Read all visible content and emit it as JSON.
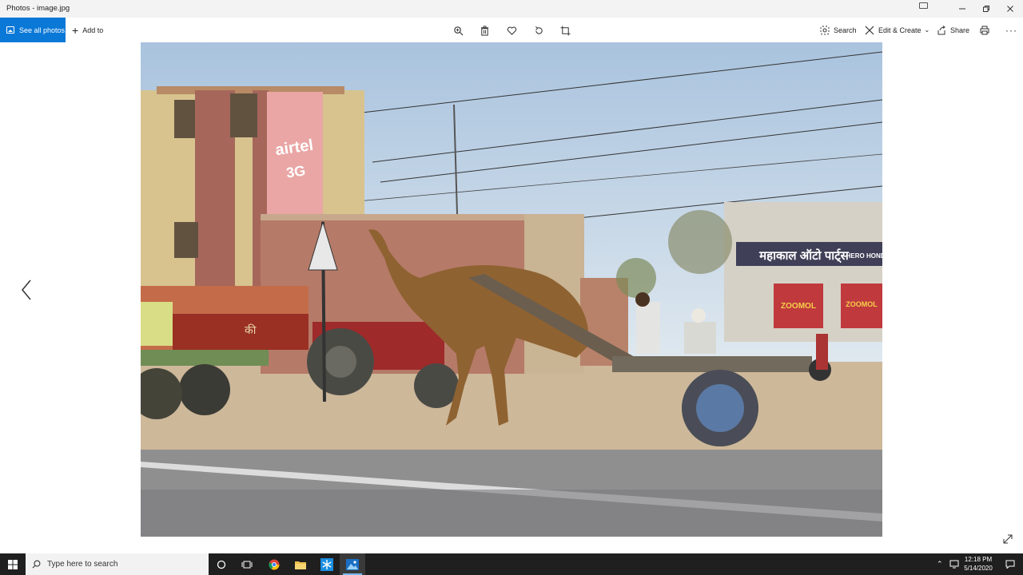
{
  "window": {
    "title": "Photos - image.jpg"
  },
  "toolbar": {
    "see_all_label": "See all photos",
    "add_to_label": "Add to",
    "search_label": "Search",
    "edit_create_label": "Edit & Create",
    "share_label": "Share"
  },
  "photo": {
    "sign_brand": "airtel",
    "sign_sub": "3G",
    "shop_sign": "महाकाल ऑटो पार्ट्स",
    "shop_sign_right": "HERO HONDA",
    "zoomol_1": "ZOOMOL",
    "zoomol_2": "ZOOMOL",
    "truck_text": "की"
  },
  "taskbar": {
    "search_placeholder": "Type here to search",
    "time": "12:18 PM",
    "date": "5/14/2020"
  },
  "colors": {
    "accent": "#0a78d7",
    "taskbar": "#1f1f1f"
  }
}
